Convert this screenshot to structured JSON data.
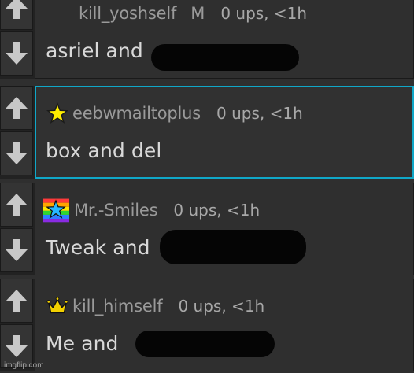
{
  "comments": [
    {
      "username": "kill_yoshself",
      "badge": "M",
      "stats": "0 ups, <1h",
      "text": "asriel and",
      "flair": "none",
      "selected": false
    },
    {
      "username": "eebwmailtoplus",
      "badge": "",
      "stats": "0 ups, <1h",
      "text": "box and del",
      "flair": "star-icon",
      "selected": true
    },
    {
      "username": "Mr.-Smiles",
      "badge": "",
      "stats": "0 ups, <1h",
      "text": "Tweak and",
      "flair": "rainbow-star-icon",
      "selected": false
    },
    {
      "username": "kill_himself",
      "badge": "",
      "stats": "0 ups, <1h",
      "text": "Me and",
      "flair": "crown-icon",
      "selected": false
    }
  ],
  "icons": {
    "upvote": "arrow-up-icon",
    "downvote": "arrow-down-icon"
  },
  "colors": {
    "selected_border": "#10a7c8",
    "star": "#ffee00",
    "crown": "#f2d000",
    "rainbow_star": "#26b8ff"
  },
  "watermark": "imgflip.com"
}
